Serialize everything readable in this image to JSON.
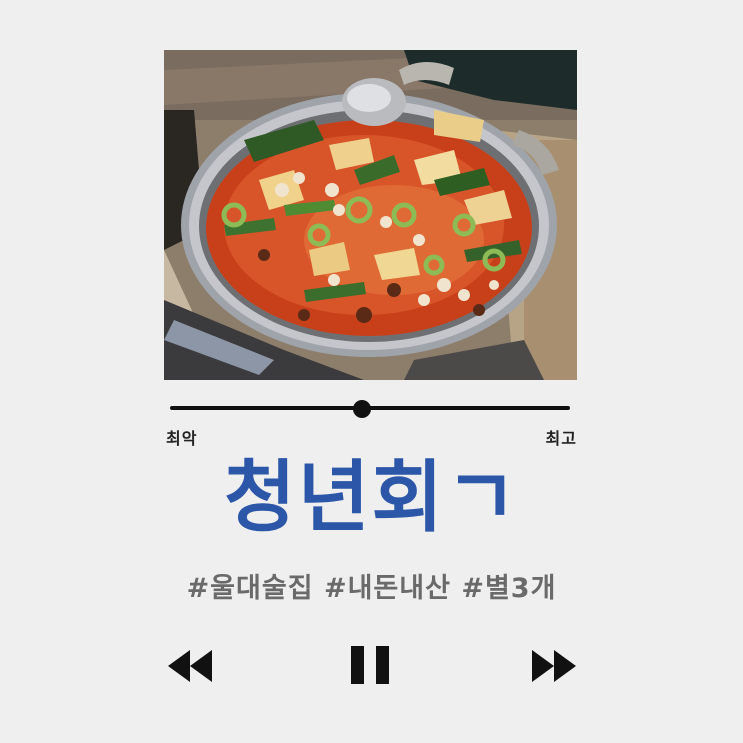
{
  "rating": {
    "min_label": "최악",
    "max_label": "최고",
    "level": 0.48
  },
  "title": "청년회ㄱ",
  "hashtags": "#울대술집 #내돈내산 #별3개",
  "colors": {
    "background": "#efefef",
    "title": "#2c56a8",
    "hashtags": "#6a6a6a",
    "controls": "#111111"
  },
  "icons": {
    "rewind": "rewind-icon",
    "pause": "pause-icon",
    "forward": "fast-forward-icon"
  }
}
